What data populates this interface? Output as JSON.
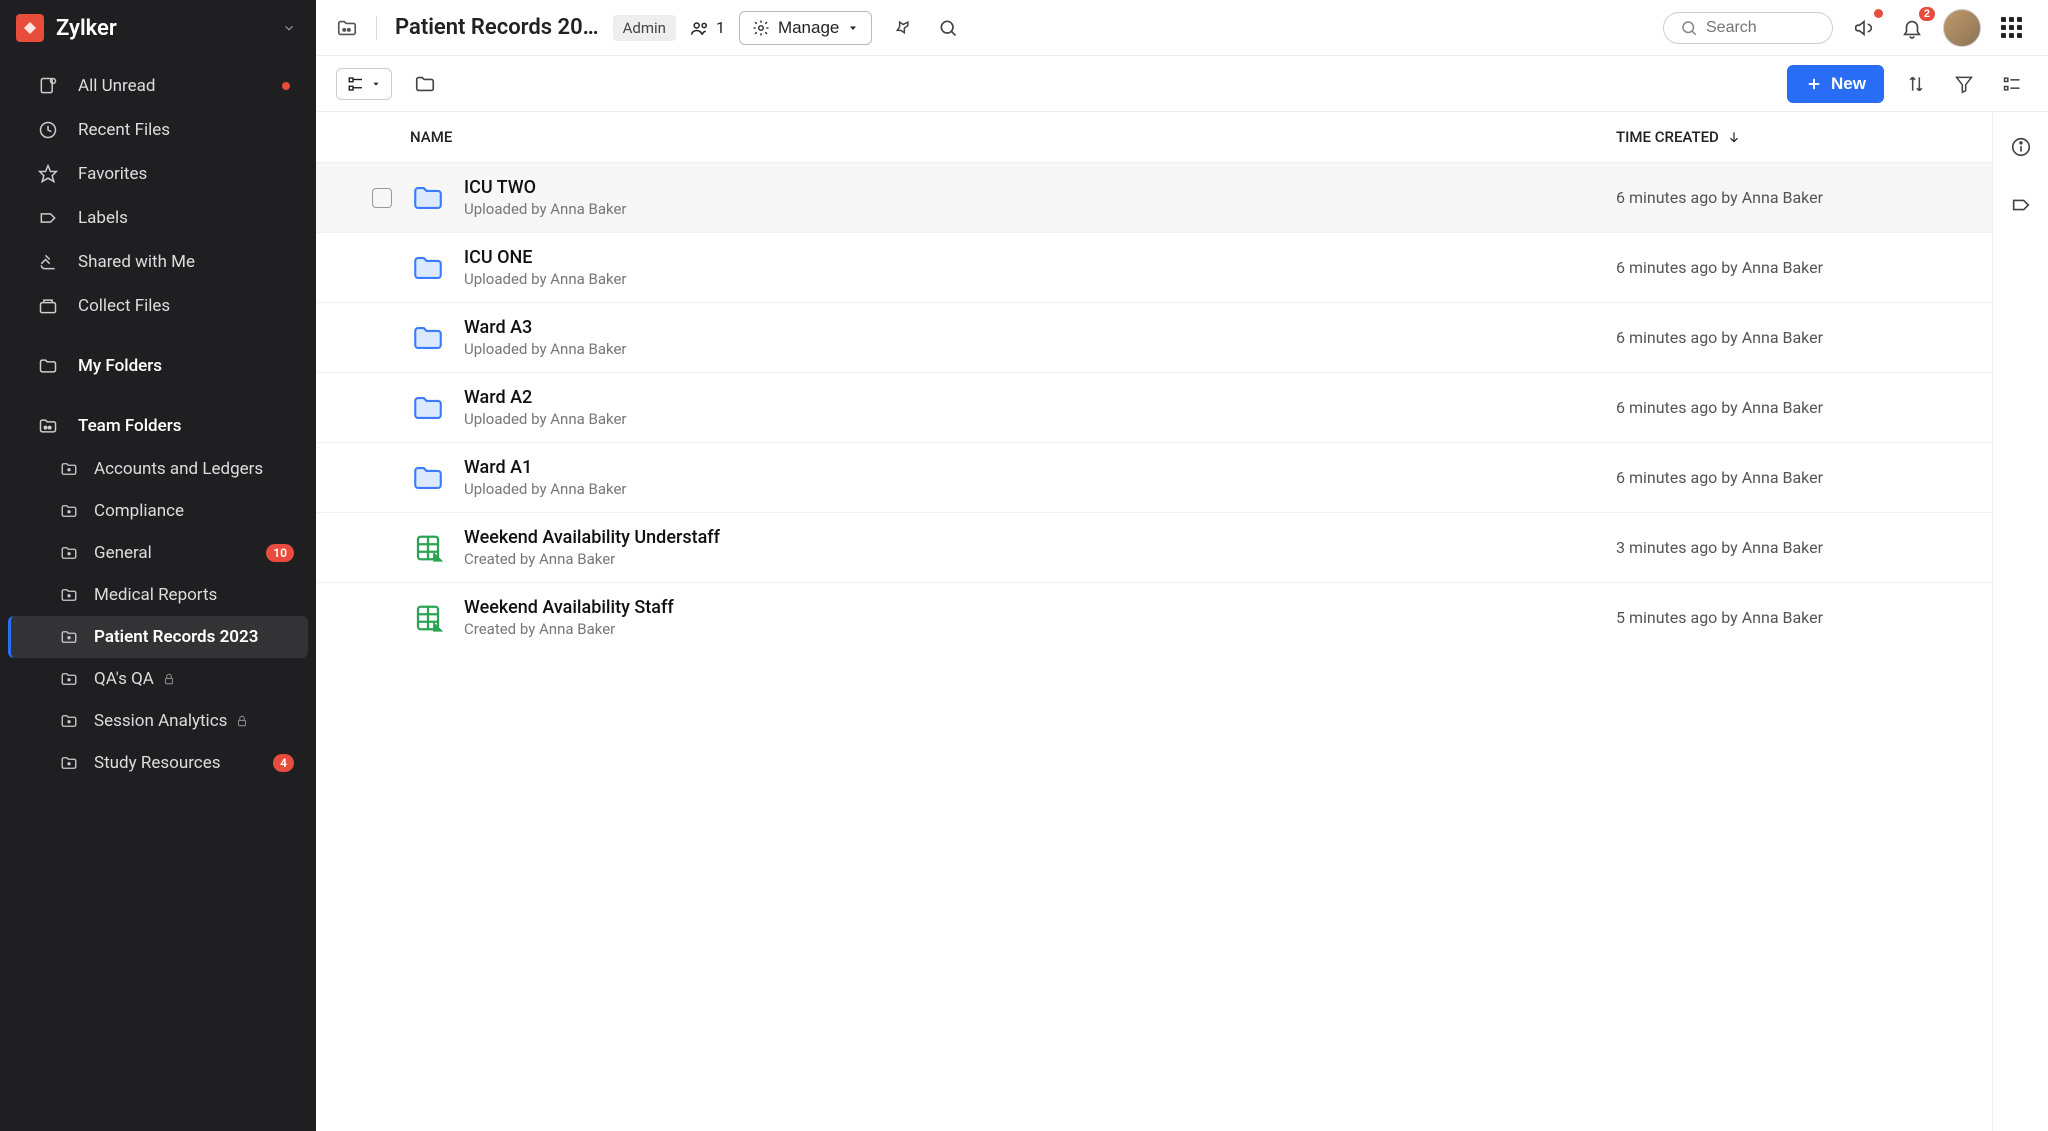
{
  "org": {
    "name": "Zylker"
  },
  "sidebar": {
    "nav": [
      {
        "label": "All Unread",
        "icon": "unread",
        "dot": true
      },
      {
        "label": "Recent Files",
        "icon": "clock"
      },
      {
        "label": "Favorites",
        "icon": "star"
      },
      {
        "label": "Labels",
        "icon": "tag"
      },
      {
        "label": "Shared with Me",
        "icon": "share"
      },
      {
        "label": "Collect Files",
        "icon": "collect"
      }
    ],
    "my_folders_label": "My Folders",
    "team_folders_label": "Team Folders",
    "team_folders": [
      {
        "label": "Accounts and Ledgers"
      },
      {
        "label": "Compliance"
      },
      {
        "label": "General",
        "badge": "10"
      },
      {
        "label": "Medical Reports"
      },
      {
        "label": "Patient Records 2023",
        "active": true
      },
      {
        "label": "QA's QA",
        "locked": true
      },
      {
        "label": "Session Analytics",
        "locked": true
      },
      {
        "label": "Study Resources",
        "badge": "4"
      }
    ]
  },
  "header": {
    "title": "Patient Records 20…",
    "role_label": "Admin",
    "member_count": "1",
    "manage_label": "Manage",
    "search_placeholder": "Search",
    "bell_badge": "2"
  },
  "toolbar": {
    "new_label": "New"
  },
  "table": {
    "col_name": "NAME",
    "col_time": "TIME CREATED",
    "rows": [
      {
        "name": "ICU TWO",
        "sub": "Uploaded by Anna Baker",
        "time": "6 minutes ago by Anna Baker",
        "type": "folder",
        "hovered": true
      },
      {
        "name": "ICU ONE",
        "sub": "Uploaded by Anna Baker",
        "time": "6 minutes ago by Anna Baker",
        "type": "folder"
      },
      {
        "name": "Ward A3",
        "sub": "Uploaded by Anna Baker",
        "time": "6 minutes ago by Anna Baker",
        "type": "folder"
      },
      {
        "name": "Ward A2",
        "sub": "Uploaded by Anna Baker",
        "time": "6 minutes ago by Anna Baker",
        "type": "folder"
      },
      {
        "name": "Ward A1",
        "sub": "Uploaded by Anna Baker",
        "time": "6 minutes ago by Anna Baker",
        "type": "folder"
      },
      {
        "name": "Weekend Availability Understaff",
        "sub": "Created by Anna Baker",
        "time": "3 minutes ago by Anna Baker",
        "type": "sheet"
      },
      {
        "name": "Weekend Availability Staff",
        "sub": "Created by Anna Baker",
        "time": "5 minutes ago by Anna Baker",
        "type": "sheet"
      }
    ]
  }
}
